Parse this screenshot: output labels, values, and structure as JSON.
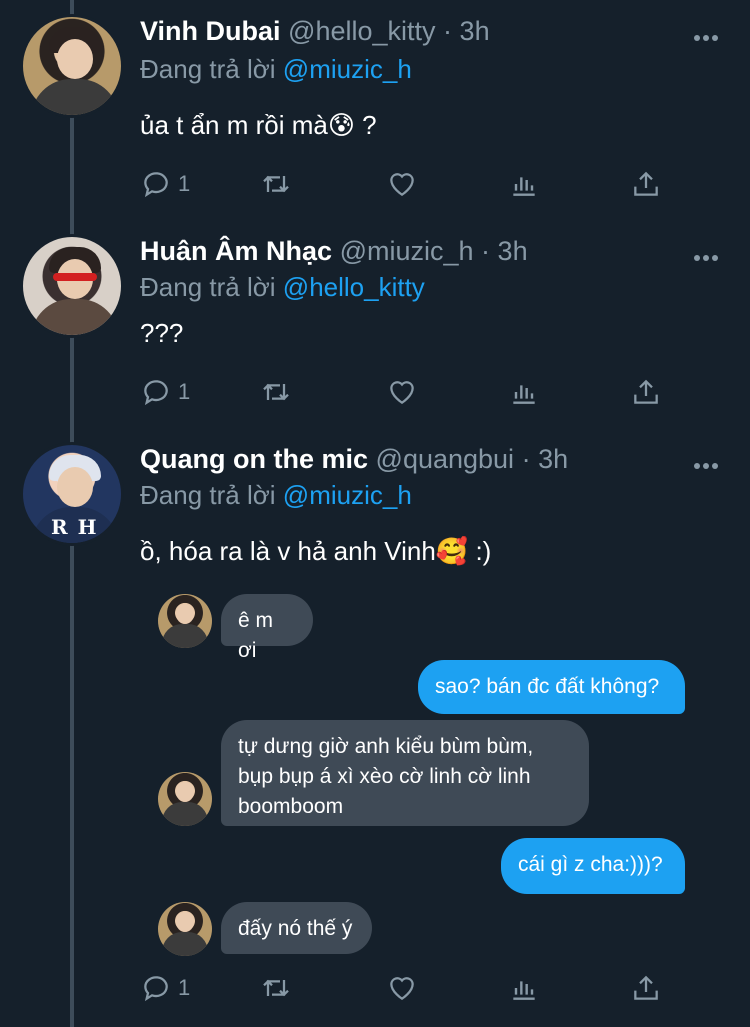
{
  "colors": {
    "background": "#15202b",
    "mention": "#1da1f2",
    "muted": "#8899a6",
    "out_bubble": "#1da1f2",
    "in_bubble": "#3f4a56"
  },
  "tweets": [
    {
      "name": "Vinh Dubai",
      "handle": "@hello_kitty",
      "time": "3h",
      "reply_prefix": "Đang trả lời",
      "reply_to": "@miuzic_h",
      "text": "ủa t ẩn m rồi mà😰 ?",
      "reply_count": "1"
    },
    {
      "name": "Huân Âm Nhạc",
      "handle": "@miuzic_h",
      "time": "3h",
      "reply_prefix": "Đang trả lời",
      "reply_to": "@hello_kitty",
      "text": "???",
      "reply_count": "1"
    },
    {
      "name": "Quang on the mic",
      "handle": "@quangbui",
      "time": "3h",
      "reply_prefix": "Đang trả lời",
      "reply_to": "@miuzic_h",
      "text": "ồ, hóa ra là v hả anh Vinh🥰 :)",
      "reply_count": "1"
    }
  ],
  "chat": [
    {
      "side": "in",
      "text": "ê m ơi"
    },
    {
      "side": "out",
      "text": "sao? bán đc đất không?"
    },
    {
      "side": "in",
      "text": "tự dưng giờ anh kiểu bùm bùm,\nbụp bụp á xì xèo cờ linh cờ linh\nboomboom"
    },
    {
      "side": "out",
      "text": "cái gì z cha:)))?"
    },
    {
      "side": "in",
      "text": "đấy nó thế ý"
    }
  ],
  "icons": [
    "reply-icon",
    "retweet-icon",
    "like-icon",
    "analytics-icon",
    "share-icon",
    "more-icon"
  ]
}
